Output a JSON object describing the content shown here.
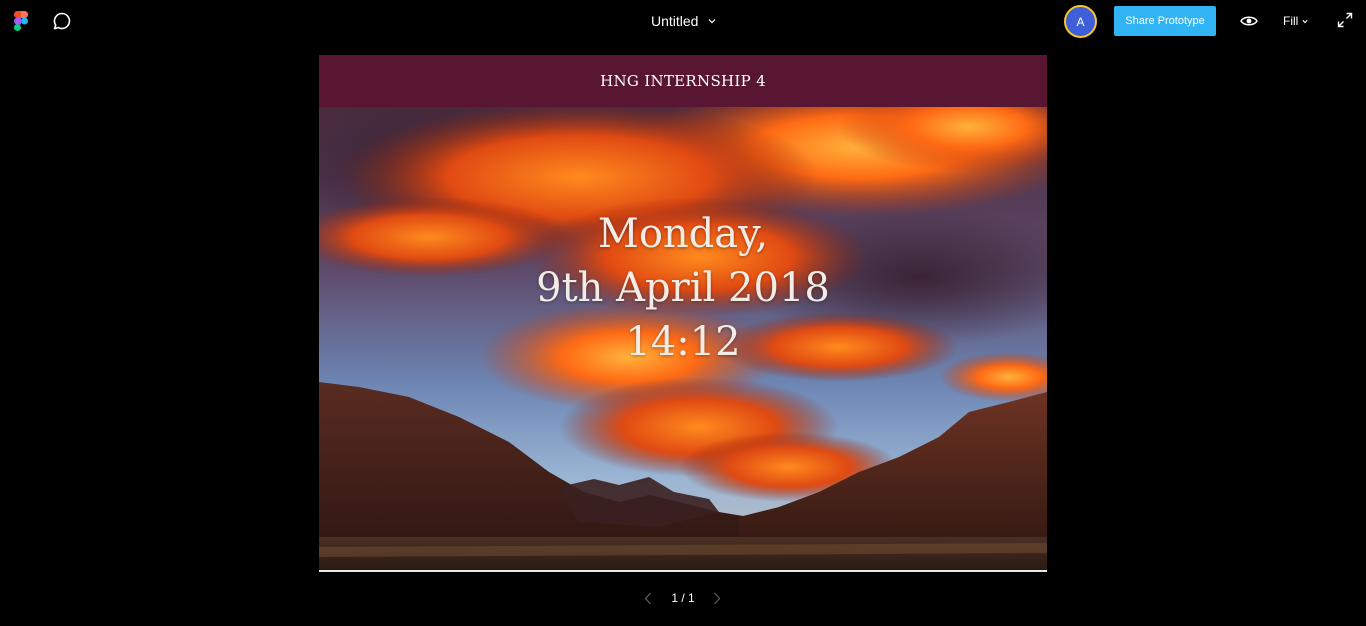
{
  "toolbar": {
    "file_title": "Untitled",
    "avatar_initial": "A",
    "share_label": "Share Prototype",
    "zoom_mode": "Fill",
    "icons": [
      "figma-logo-icon",
      "comment-icon",
      "chevron-down-icon",
      "eye-icon",
      "expand-icon"
    ]
  },
  "prototype": {
    "header": "HNG INTERNSHIP 4",
    "day": "Monday,",
    "date": "9th April 2018",
    "time": "14:12"
  },
  "pager": {
    "label": "1 / 1",
    "icons": [
      "chevron-left-icon",
      "chevron-right-icon"
    ]
  },
  "colors": {
    "background": "#000000",
    "header_bar": "#591633",
    "share_button": "#30b4f4",
    "avatar_ring": "#f7c82f",
    "avatar_fill": "#3f5fd8"
  }
}
